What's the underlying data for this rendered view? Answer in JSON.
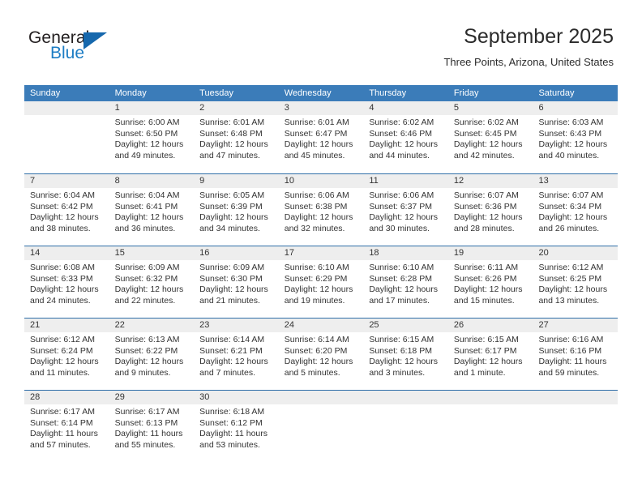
{
  "brand": {
    "word_general": "General",
    "word_blue": "Blue",
    "triangle_icon": "logo-triangle-icon",
    "accent_blue": "#1d7dc4",
    "header_blue": "#3b7cb9"
  },
  "header": {
    "title": "September 2025",
    "subtitle": "Three Points, Arizona, United States"
  },
  "calendar": {
    "weekdays": [
      "Sunday",
      "Monday",
      "Tuesday",
      "Wednesday",
      "Thursday",
      "Friday",
      "Saturday"
    ],
    "weeks": [
      [
        {
          "day": "",
          "sunrise": "",
          "sunset": "",
          "daylight": "",
          "empty": true
        },
        {
          "day": "1",
          "sunrise": "Sunrise: 6:00 AM",
          "sunset": "Sunset: 6:50 PM",
          "daylight": "Daylight: 12 hours and 49 minutes."
        },
        {
          "day": "2",
          "sunrise": "Sunrise: 6:01 AM",
          "sunset": "Sunset: 6:48 PM",
          "daylight": "Daylight: 12 hours and 47 minutes."
        },
        {
          "day": "3",
          "sunrise": "Sunrise: 6:01 AM",
          "sunset": "Sunset: 6:47 PM",
          "daylight": "Daylight: 12 hours and 45 minutes."
        },
        {
          "day": "4",
          "sunrise": "Sunrise: 6:02 AM",
          "sunset": "Sunset: 6:46 PM",
          "daylight": "Daylight: 12 hours and 44 minutes."
        },
        {
          "day": "5",
          "sunrise": "Sunrise: 6:02 AM",
          "sunset": "Sunset: 6:45 PM",
          "daylight": "Daylight: 12 hours and 42 minutes."
        },
        {
          "day": "6",
          "sunrise": "Sunrise: 6:03 AM",
          "sunset": "Sunset: 6:43 PM",
          "daylight": "Daylight: 12 hours and 40 minutes."
        }
      ],
      [
        {
          "day": "7",
          "sunrise": "Sunrise: 6:04 AM",
          "sunset": "Sunset: 6:42 PM",
          "daylight": "Daylight: 12 hours and 38 minutes."
        },
        {
          "day": "8",
          "sunrise": "Sunrise: 6:04 AM",
          "sunset": "Sunset: 6:41 PM",
          "daylight": "Daylight: 12 hours and 36 minutes."
        },
        {
          "day": "9",
          "sunrise": "Sunrise: 6:05 AM",
          "sunset": "Sunset: 6:39 PM",
          "daylight": "Daylight: 12 hours and 34 minutes."
        },
        {
          "day": "10",
          "sunrise": "Sunrise: 6:06 AM",
          "sunset": "Sunset: 6:38 PM",
          "daylight": "Daylight: 12 hours and 32 minutes."
        },
        {
          "day": "11",
          "sunrise": "Sunrise: 6:06 AM",
          "sunset": "Sunset: 6:37 PM",
          "daylight": "Daylight: 12 hours and 30 minutes."
        },
        {
          "day": "12",
          "sunrise": "Sunrise: 6:07 AM",
          "sunset": "Sunset: 6:36 PM",
          "daylight": "Daylight: 12 hours and 28 minutes."
        },
        {
          "day": "13",
          "sunrise": "Sunrise: 6:07 AM",
          "sunset": "Sunset: 6:34 PM",
          "daylight": "Daylight: 12 hours and 26 minutes."
        }
      ],
      [
        {
          "day": "14",
          "sunrise": "Sunrise: 6:08 AM",
          "sunset": "Sunset: 6:33 PM",
          "daylight": "Daylight: 12 hours and 24 minutes."
        },
        {
          "day": "15",
          "sunrise": "Sunrise: 6:09 AM",
          "sunset": "Sunset: 6:32 PM",
          "daylight": "Daylight: 12 hours and 22 minutes."
        },
        {
          "day": "16",
          "sunrise": "Sunrise: 6:09 AM",
          "sunset": "Sunset: 6:30 PM",
          "daylight": "Daylight: 12 hours and 21 minutes."
        },
        {
          "day": "17",
          "sunrise": "Sunrise: 6:10 AM",
          "sunset": "Sunset: 6:29 PM",
          "daylight": "Daylight: 12 hours and 19 minutes."
        },
        {
          "day": "18",
          "sunrise": "Sunrise: 6:10 AM",
          "sunset": "Sunset: 6:28 PM",
          "daylight": "Daylight: 12 hours and 17 minutes."
        },
        {
          "day": "19",
          "sunrise": "Sunrise: 6:11 AM",
          "sunset": "Sunset: 6:26 PM",
          "daylight": "Daylight: 12 hours and 15 minutes."
        },
        {
          "day": "20",
          "sunrise": "Sunrise: 6:12 AM",
          "sunset": "Sunset: 6:25 PM",
          "daylight": "Daylight: 12 hours and 13 minutes."
        }
      ],
      [
        {
          "day": "21",
          "sunrise": "Sunrise: 6:12 AM",
          "sunset": "Sunset: 6:24 PM",
          "daylight": "Daylight: 12 hours and 11 minutes."
        },
        {
          "day": "22",
          "sunrise": "Sunrise: 6:13 AM",
          "sunset": "Sunset: 6:22 PM",
          "daylight": "Daylight: 12 hours and 9 minutes."
        },
        {
          "day": "23",
          "sunrise": "Sunrise: 6:14 AM",
          "sunset": "Sunset: 6:21 PM",
          "daylight": "Daylight: 12 hours and 7 minutes."
        },
        {
          "day": "24",
          "sunrise": "Sunrise: 6:14 AM",
          "sunset": "Sunset: 6:20 PM",
          "daylight": "Daylight: 12 hours and 5 minutes."
        },
        {
          "day": "25",
          "sunrise": "Sunrise: 6:15 AM",
          "sunset": "Sunset: 6:18 PM",
          "daylight": "Daylight: 12 hours and 3 minutes."
        },
        {
          "day": "26",
          "sunrise": "Sunrise: 6:15 AM",
          "sunset": "Sunset: 6:17 PM",
          "daylight": "Daylight: 12 hours and 1 minute."
        },
        {
          "day": "27",
          "sunrise": "Sunrise: 6:16 AM",
          "sunset": "Sunset: 6:16 PM",
          "daylight": "Daylight: 11 hours and 59 minutes."
        }
      ],
      [
        {
          "day": "28",
          "sunrise": "Sunrise: 6:17 AM",
          "sunset": "Sunset: 6:14 PM",
          "daylight": "Daylight: 11 hours and 57 minutes."
        },
        {
          "day": "29",
          "sunrise": "Sunrise: 6:17 AM",
          "sunset": "Sunset: 6:13 PM",
          "daylight": "Daylight: 11 hours and 55 minutes."
        },
        {
          "day": "30",
          "sunrise": "Sunrise: 6:18 AM",
          "sunset": "Sunset: 6:12 PM",
          "daylight": "Daylight: 11 hours and 53 minutes."
        },
        {
          "day": "",
          "sunrise": "",
          "sunset": "",
          "daylight": "",
          "empty": true
        },
        {
          "day": "",
          "sunrise": "",
          "sunset": "",
          "daylight": "",
          "empty": true
        },
        {
          "day": "",
          "sunrise": "",
          "sunset": "",
          "daylight": "",
          "empty": true
        },
        {
          "day": "",
          "sunrise": "",
          "sunset": "",
          "daylight": "",
          "empty": true
        }
      ]
    ]
  }
}
